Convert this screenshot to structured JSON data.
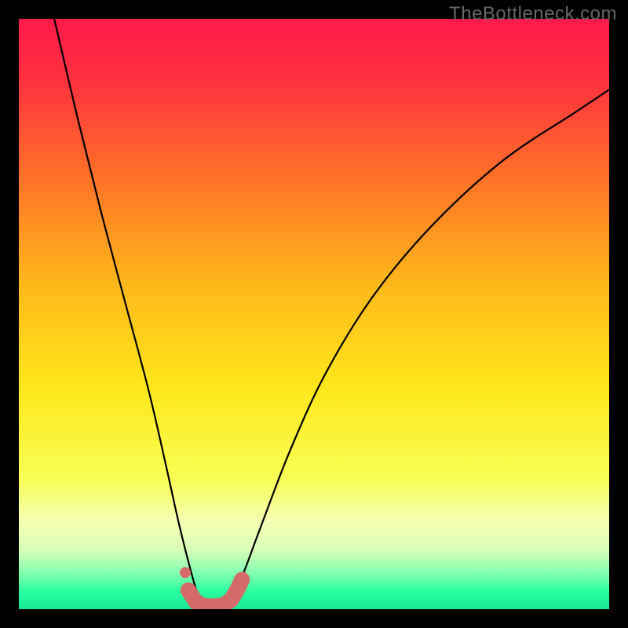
{
  "watermark": "TheBottleneck.com",
  "colors": {
    "bg": "#000000",
    "gradient_stops": [
      {
        "offset": 0.0,
        "color": "#ff1a4a"
      },
      {
        "offset": 0.1,
        "color": "#ff3040"
      },
      {
        "offset": 0.25,
        "color": "#ff6a2a"
      },
      {
        "offset": 0.45,
        "color": "#ffb81a"
      },
      {
        "offset": 0.62,
        "color": "#ffe61a"
      },
      {
        "offset": 0.78,
        "color": "#f8ff55"
      },
      {
        "offset": 0.85,
        "color": "#f5ffb2"
      },
      {
        "offset": 0.9,
        "color": "#d8ffb8"
      },
      {
        "offset": 0.94,
        "color": "#80ffb0"
      },
      {
        "offset": 0.97,
        "color": "#2affa0"
      },
      {
        "offset": 1.0,
        "color": "#18e898"
      }
    ],
    "curve": "#000000",
    "marker_fill": "#d46a6a",
    "marker_stroke": "#c85a5a"
  },
  "chart_data": {
    "type": "line",
    "title": "",
    "xlabel": "",
    "ylabel": "",
    "xlim": [
      0,
      100
    ],
    "ylim": [
      0,
      100
    ],
    "series": [
      {
        "name": "bottleneck-curve",
        "x": [
          6,
          10,
          14,
          18,
          22,
          25,
          27,
          29,
          30.5,
          32,
          34,
          36,
          38,
          41,
          46,
          52,
          60,
          70,
          82,
          94,
          100
        ],
        "values": [
          100,
          83,
          67,
          52,
          37,
          24,
          15,
          7,
          2,
          0.6,
          0.6,
          2,
          6,
          14,
          27,
          40,
          53,
          65,
          76,
          84,
          88
        ]
      }
    ],
    "markers": {
      "name": "highlight-band",
      "x": [
        28.7,
        30.0,
        31.5,
        33.0,
        34.5,
        36.0,
        37.0,
        37.8
      ],
      "values": [
        3.2,
        1.2,
        0.5,
        0.5,
        0.6,
        1.6,
        3.3,
        5.0
      ]
    }
  }
}
